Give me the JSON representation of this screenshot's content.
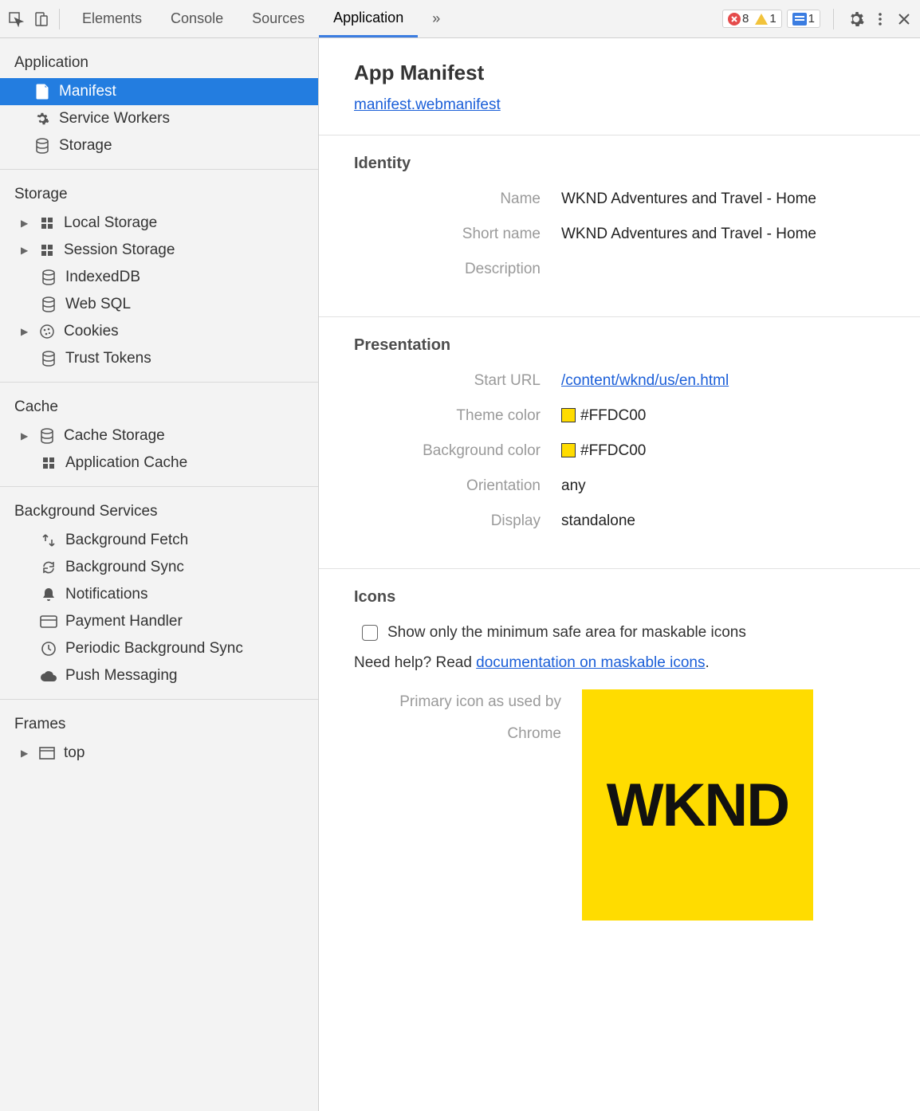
{
  "tabs": {
    "elements": "Elements",
    "console": "Console",
    "sources": "Sources",
    "application": "Application"
  },
  "badges": {
    "errors": "8",
    "warnings": "1",
    "messages": "1"
  },
  "sidebar": {
    "application": {
      "heading": "Application",
      "manifest": "Manifest",
      "service_workers": "Service Workers",
      "storage": "Storage"
    },
    "storage": {
      "heading": "Storage",
      "local_storage": "Local Storage",
      "session_storage": "Session Storage",
      "indexeddb": "IndexedDB",
      "web_sql": "Web SQL",
      "cookies": "Cookies",
      "trust_tokens": "Trust Tokens"
    },
    "cache": {
      "heading": "Cache",
      "cache_storage": "Cache Storage",
      "application_cache": "Application Cache"
    },
    "bg": {
      "heading": "Background Services",
      "background_fetch": "Background Fetch",
      "background_sync": "Background Sync",
      "notifications": "Notifications",
      "payment_handler": "Payment Handler",
      "periodic_bg_sync": "Periodic Background Sync",
      "push_messaging": "Push Messaging"
    },
    "frames": {
      "heading": "Frames",
      "top": "top"
    }
  },
  "manifest": {
    "title": "App Manifest",
    "file": "manifest.webmanifest",
    "identity_heading": "Identity",
    "labels": {
      "name": "Name",
      "short_name": "Short name",
      "description": "Description",
      "start_url": "Start URL",
      "theme_color": "Theme color",
      "background_color": "Background color",
      "orientation": "Orientation",
      "display": "Display"
    },
    "identity": {
      "name": "WKND Adventures and Travel - Home",
      "short_name": "WKND Adventures and Travel - Home",
      "description": ""
    },
    "presentation_heading": "Presentation",
    "presentation": {
      "start_url": "/content/wknd/us/en.html",
      "theme_color": "#FFDC00",
      "background_color": "#FFDC00",
      "orientation": "any",
      "display": "standalone"
    },
    "icons_heading": "Icons",
    "icons": {
      "checkbox_label": "Show only the minimum safe area for maskable icons",
      "help_prefix": "Need help? Read ",
      "help_link": "documentation on maskable icons",
      "help_suffix": ".",
      "primary_label_l1": "Primary icon as used by",
      "primary_label_l2": "Chrome",
      "logo_text": "WKND"
    }
  }
}
